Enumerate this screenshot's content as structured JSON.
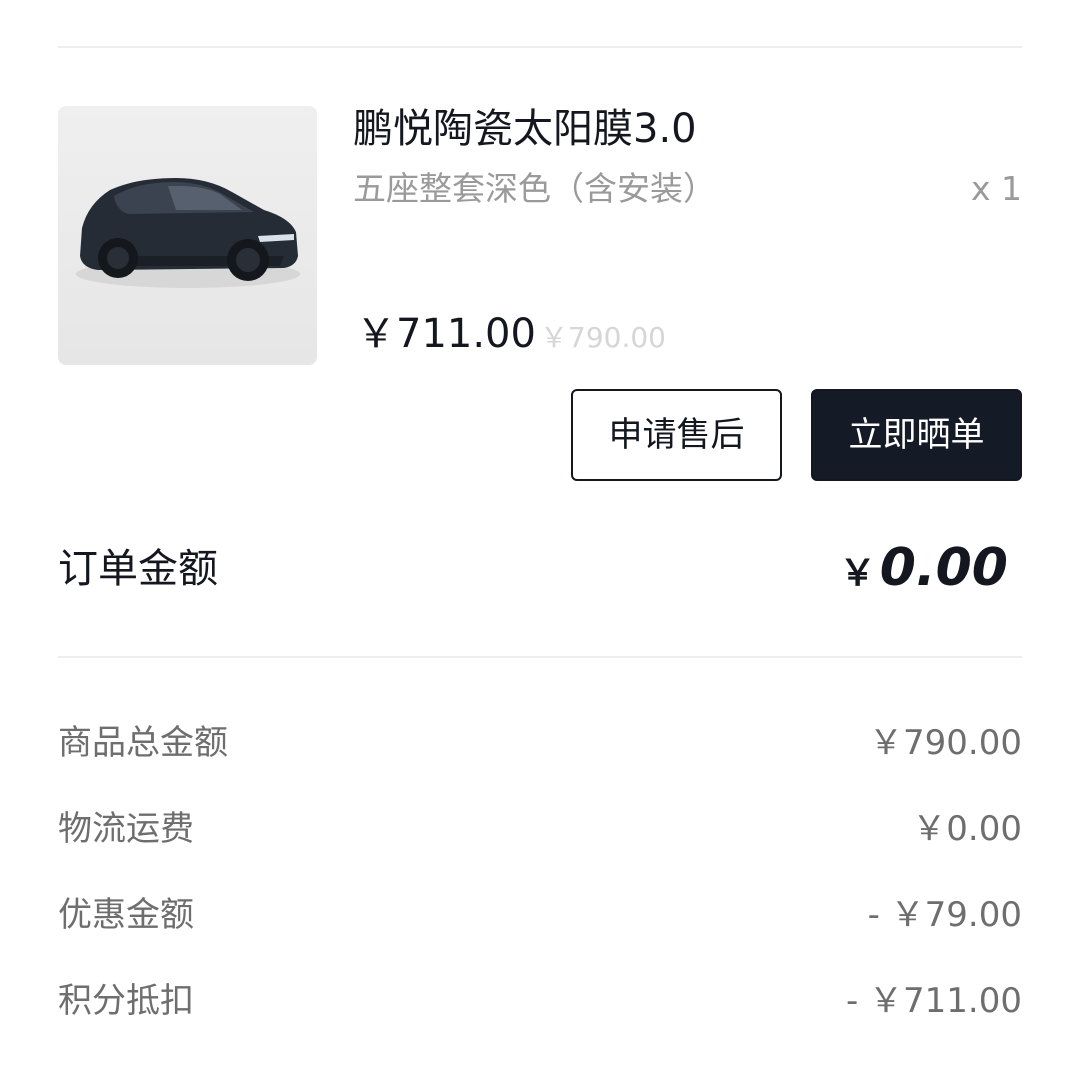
{
  "product": {
    "title": "鹏悦陶瓷太阳膜3.0",
    "spec": "五座整套深色（含安装）",
    "quantity": "x 1",
    "price": "￥711.00",
    "original_price": "￥790.00",
    "image_subject": "car-icon"
  },
  "actions": {
    "after_sales_label": "申请售后",
    "share_label": "立即晒单"
  },
  "order": {
    "label": "订单金额",
    "currency": "￥",
    "amount": "0.00"
  },
  "summary": [
    {
      "label": "商品总金额",
      "amount": "￥790.00"
    },
    {
      "label": "物流运费",
      "amount": "￥0.00"
    },
    {
      "label": "优惠金额",
      "amount": "- ￥79.00"
    },
    {
      "label": "积分抵扣",
      "amount": "- ￥711.00"
    }
  ],
  "colors": {
    "primary": "#141a26",
    "muted_text": "#9a9a9a",
    "strike_price": "#d6d6d6",
    "divider": "#eeeeee"
  }
}
